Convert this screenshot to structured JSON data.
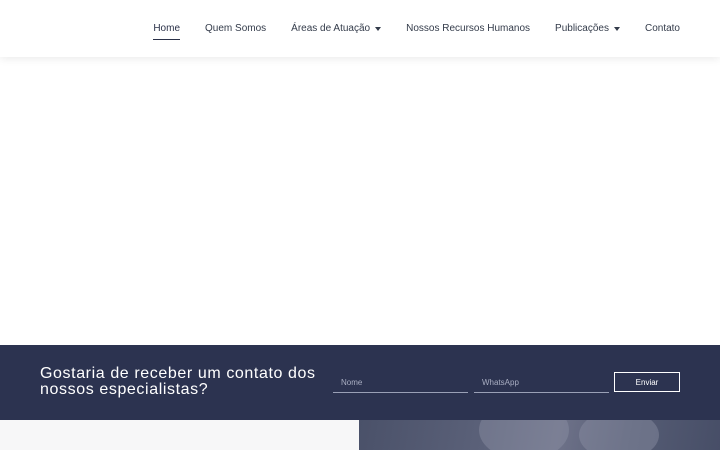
{
  "nav": {
    "items": [
      {
        "label": "Home",
        "active": true,
        "dropdown": false
      },
      {
        "label": "Quem Somos",
        "active": false,
        "dropdown": false
      },
      {
        "label": "Áreas de Atuação",
        "active": false,
        "dropdown": true
      },
      {
        "label": "Nossos Recursos Humanos",
        "active": false,
        "dropdown": false
      },
      {
        "label": "Publicações",
        "active": false,
        "dropdown": true
      },
      {
        "label": "Contato",
        "active": false,
        "dropdown": false
      }
    ]
  },
  "cta": {
    "title_line1": "Gostaria de receber um contato dos",
    "title_line2": "nossos especialistas?",
    "name_placeholder": "Nome",
    "whatsapp_placeholder": "WhatsApp",
    "send_label": "Enviar"
  },
  "colors": {
    "navy": "#2c3350",
    "nav_text": "#333b4a"
  }
}
